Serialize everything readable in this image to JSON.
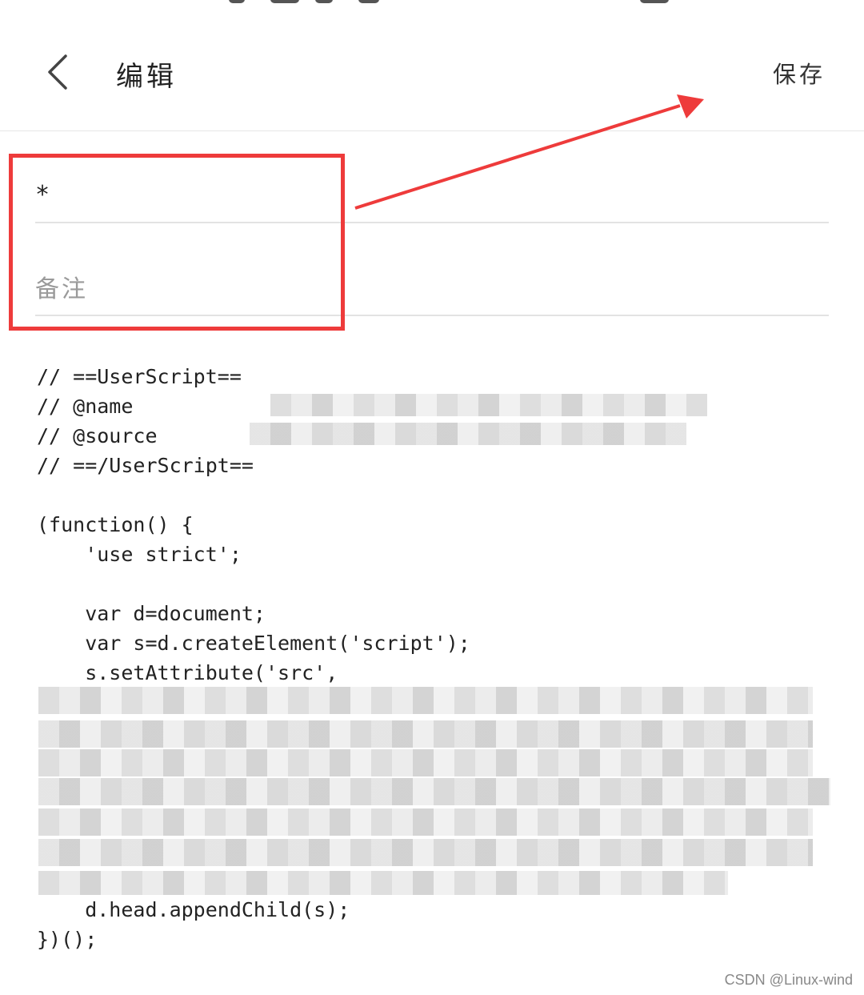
{
  "header": {
    "back_icon": "chevron-left-icon",
    "title": "编辑",
    "save_label": "保存"
  },
  "form": {
    "name_value": "*",
    "note_placeholder": "备注"
  },
  "code": {
    "lines": [
      "// ==UserScript==",
      "// @name",
      "// @source",
      "// ==/UserScript==",
      "",
      "(function() {",
      "    'use strict';",
      "",
      "    var d=document;",
      "    var s=d.createElement('script');",
      "    s.setAttribute('src',",
      "",
      "",
      "",
      "",
      "",
      "",
      "",
      "    d.head.appendChild(s);",
      "})();"
    ]
  },
  "annotation": {
    "box_color": "#ee3b3b",
    "arrow_color": "#ee3b3b"
  },
  "watermark": "CSDN @Linux-wind"
}
